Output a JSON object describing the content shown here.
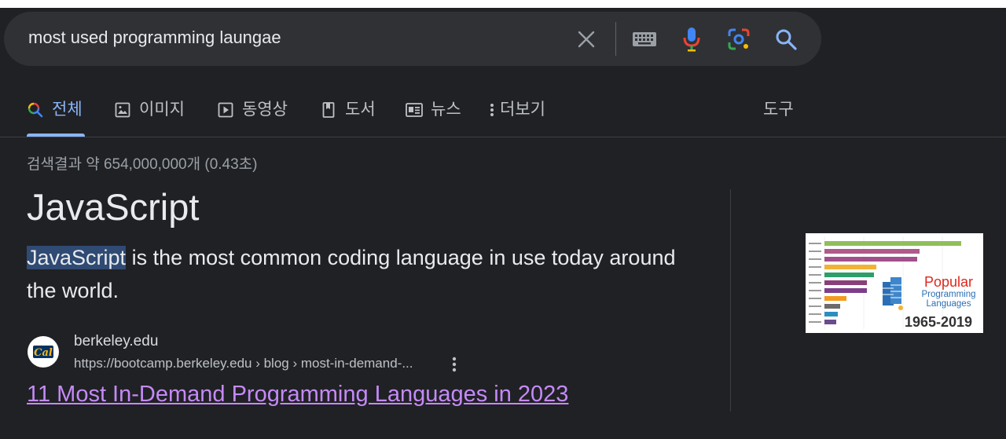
{
  "search": {
    "query": "most used programming laungae"
  },
  "tabs": [
    {
      "label": "전체",
      "icon": "search-icon"
    },
    {
      "label": "이미지",
      "icon": "image-icon"
    },
    {
      "label": "동영상",
      "icon": "video-icon"
    },
    {
      "label": "도서",
      "icon": "book-icon"
    },
    {
      "label": "뉴스",
      "icon": "news-icon"
    },
    {
      "label": "더보기",
      "icon": "more-vert-icon"
    }
  ],
  "tools_label": "도구",
  "result_stats": "검색결과 약 654,000,000개 (0.43초)",
  "featured": {
    "title": "JavaScript",
    "highlight": "JavaScript",
    "body_rest": " is the most common coding language in use today around the world."
  },
  "source": {
    "site": "berkeley.edu",
    "url": "https://bootcamp.berkeley.edu › blog › most-in-demand-...",
    "link_text": "11 Most In-Demand Programming Languages in 2023",
    "favicon_text": "Cal"
  },
  "thumbnail": {
    "title_line1": "Popular",
    "title_line2": "Programming",
    "title_line3": "Languages",
    "years": "1965-2019"
  },
  "colors": {
    "background": "#202124",
    "search_bar": "#303134",
    "accent": "#8ab4f8",
    "visited_link": "#c58af9",
    "highlight": "#2f4a73"
  }
}
